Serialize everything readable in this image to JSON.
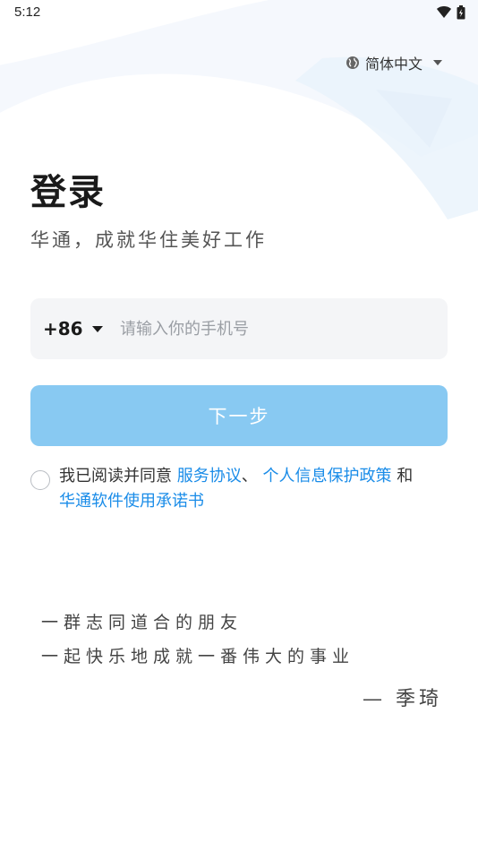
{
  "status_bar": {
    "time": "5:12"
  },
  "language": {
    "label": "简体中文"
  },
  "login": {
    "title": "登录",
    "subtitle": "华通，成就华住美好工作"
  },
  "phone": {
    "country_code": "+86",
    "placeholder": "请输入你的手机号",
    "value": ""
  },
  "next_button": {
    "label": "下一步"
  },
  "agreement": {
    "prefix": "我已阅读并同意 ",
    "link_service": "服务协议",
    "sep": "、 ",
    "link_privacy": "个人信息保护政策",
    "and": " 和",
    "link_commitment": "华通软件使用承诺书"
  },
  "quote": {
    "line1": "一群志同道合的朋友",
    "line2": "一起快乐地成就一番伟大的事业",
    "author": "— 季琦"
  },
  "colors": {
    "accent": "#1a8ce8",
    "button_disabled": "#88c9f2",
    "input_bg": "#f4f5f7"
  }
}
